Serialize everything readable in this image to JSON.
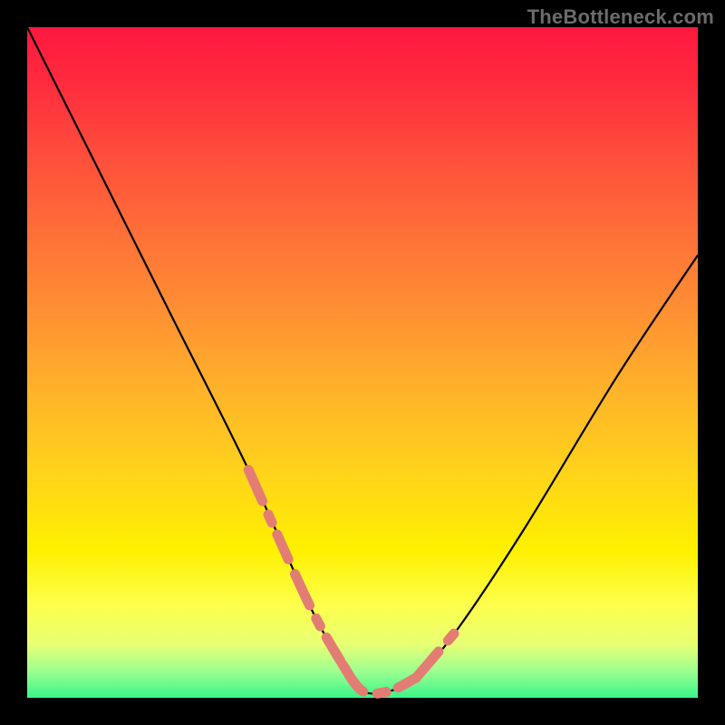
{
  "watermark": {
    "text": "TheBottleneck.com"
  },
  "chart_data": {
    "type": "line",
    "title": "",
    "xlabel": "",
    "ylabel": "",
    "xlim": [
      0,
      100
    ],
    "ylim": [
      0,
      100
    ],
    "series": [
      {
        "name": "curve",
        "x": [
          0,
          11,
          22,
          33,
          42,
          47,
          50,
          54,
          58,
          64,
          74,
          88,
          100
        ],
        "values": [
          100,
          78,
          56,
          34,
          14,
          5,
          1,
          1,
          3,
          10,
          25,
          48,
          66
        ]
      }
    ],
    "highlight_segments": [
      {
        "from_index": 3,
        "to_index": 5
      },
      {
        "from_index": 5,
        "to_index": 8
      },
      {
        "from_index": 8,
        "to_index": 9
      }
    ],
    "colors": {
      "curve": "#000000",
      "highlight": "#e37d74",
      "gradient_top": "#ff183f",
      "gradient_bottom": "#38f48a"
    }
  }
}
